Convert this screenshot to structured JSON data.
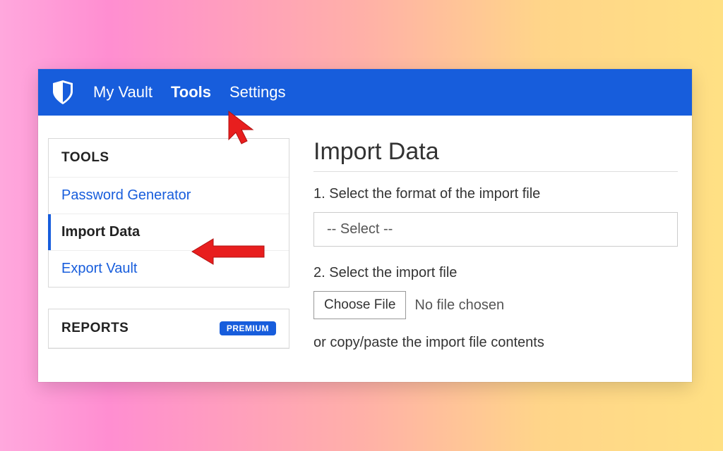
{
  "nav": {
    "items": [
      {
        "label": "My Vault",
        "active": false
      },
      {
        "label": "Tools",
        "active": true
      },
      {
        "label": "Settings",
        "active": false
      }
    ]
  },
  "sidebar": {
    "tools": {
      "header": "TOOLS",
      "items": [
        {
          "label": "Password Generator",
          "active": false
        },
        {
          "label": "Import Data",
          "active": true
        },
        {
          "label": "Export Vault",
          "active": false
        }
      ]
    },
    "reports": {
      "header": "REPORTS",
      "badge": "PREMIUM"
    }
  },
  "main": {
    "title": "Import Data",
    "step1_label": "1. Select the format of the import file",
    "select_placeholder": "-- Select --",
    "step2_label": "2. Select the import file",
    "choose_file_btn": "Choose File",
    "file_status": "No file chosen",
    "paste_label": "or copy/paste the import file contents"
  },
  "colors": {
    "brand": "#175ddc",
    "annotation": "#e81e1e"
  }
}
